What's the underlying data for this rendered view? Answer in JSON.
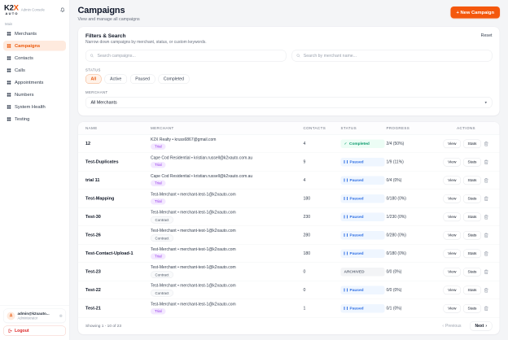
{
  "brand": {
    "logo_k2": "K2",
    "logo_x": "X",
    "logo_auto": "AUTO",
    "console_label": "Admin Console"
  },
  "sidebar": {
    "section_label": "Main",
    "items": [
      {
        "label": "Merchants",
        "active": false
      },
      {
        "label": "Campaigns",
        "active": true
      },
      {
        "label": "Contacts",
        "active": false
      },
      {
        "label": "Calls",
        "active": false
      },
      {
        "label": "Appointments",
        "active": false
      },
      {
        "label": "Numbers",
        "active": false
      },
      {
        "label": "System Health",
        "active": false
      },
      {
        "label": "Testing",
        "active": false
      }
    ],
    "user": {
      "avatar_initial": "A",
      "email": "admin@k2xauto...",
      "role": "Administrator"
    },
    "logout_label": "Logout"
  },
  "header": {
    "title": "Campaigns",
    "subtitle": "View and manage all campaigns",
    "new_campaign_label": "+ New Campaign"
  },
  "filters": {
    "title": "Filters & Search",
    "subtitle": "Narrow down campaigns by merchant, status, or custom keywords.",
    "reset_label": "Reset",
    "search_campaigns_placeholder": "Search campaigns...",
    "search_merchant_placeholder": "Search by merchant name...",
    "status_label": "STATUS",
    "status_options": [
      "All",
      "Active",
      "Paused",
      "Completed"
    ],
    "active_status": "All",
    "merchant_label": "MERCHANT",
    "merchant_value": "All Merchants"
  },
  "table": {
    "columns": [
      "NAME",
      "MERCHANT",
      "CONTACTS",
      "STATUS",
      "PROGRESS",
      "ACTIONS"
    ],
    "view_label": "View",
    "stats_label": "Stats",
    "rows": [
      {
        "name": "12",
        "merchant": "K2X Realty • kruss6867@gmail.com",
        "badge": "Trial",
        "badge_kind": "trial",
        "contacts": 4,
        "status": "Completed",
        "status_kind": "completed",
        "progress": "2/4 (50%)"
      },
      {
        "name": "Test-Duplicates",
        "merchant": "Cape Cod Residential • kristian.russell@k2xauto.com.au",
        "badge": "Trial",
        "badge_kind": "trial",
        "contacts": 9,
        "status": "Paused",
        "status_kind": "paused",
        "progress": "1/9 (11%)"
      },
      {
        "name": "trial 11",
        "merchant": "Cape Cod Residential • kristian.russell@k2xauto.com.au",
        "badge": "Trial",
        "badge_kind": "trial",
        "contacts": 4,
        "status": "Paused",
        "status_kind": "paused",
        "progress": "0/4 (0%)"
      },
      {
        "name": "Test-Mapping",
        "merchant": "Test-Merchant • merchant-test-1@k2xauto.com",
        "badge": "Trial",
        "badge_kind": "trial",
        "contacts": 180,
        "status": "Paused",
        "status_kind": "paused",
        "progress": "0/180 (0%)"
      },
      {
        "name": "Test-30",
        "merchant": "Test-Merchant • merchant-test-1@k2xauto.com",
        "badge": "Contract",
        "badge_kind": "contract",
        "contacts": 230,
        "status": "Paused",
        "status_kind": "paused",
        "progress": "1/230 (0%)"
      },
      {
        "name": "Test-26",
        "merchant": "Test-Merchant • merchant-test-1@k2xauto.com",
        "badge": "Contract",
        "badge_kind": "contract",
        "contacts": 280,
        "status": "Paused",
        "status_kind": "paused",
        "progress": "0/280 (0%)"
      },
      {
        "name": "Test-Contact-Upload-1",
        "merchant": "Test-Merchant • merchant-test-1@k2xauto.com",
        "badge": "Trial",
        "badge_kind": "trial",
        "contacts": 180,
        "status": "Paused",
        "status_kind": "paused",
        "progress": "0/180 (0%)"
      },
      {
        "name": "Test-23",
        "merchant": "Test-Merchant • merchant-test-1@k2xauto.com",
        "badge": "Contract",
        "badge_kind": "contract",
        "contacts": 0,
        "status": "ARCHIVED",
        "status_kind": "archived",
        "progress": "0/0 (0%)"
      },
      {
        "name": "Test-22",
        "merchant": "Test-Merchant • merchant-test-1@k2xauto.com",
        "badge": "Contract",
        "badge_kind": "contract",
        "contacts": 0,
        "status": "Paused",
        "status_kind": "paused",
        "progress": "0/0 (0%)"
      },
      {
        "name": "Test-21",
        "merchant": "Test-Merchant • merchant-test-1@k2xauto.com",
        "badge": "Trial",
        "badge_kind": "trial",
        "contacts": 1,
        "status": "Paused",
        "status_kind": "paused",
        "progress": "0/1 (0%)"
      }
    ]
  },
  "pagination": {
    "summary": "Showing 1 - 10 of 23",
    "previous_label": "Previous",
    "next_label": "Next"
  },
  "colors": {
    "accent_orange": "#f4570c",
    "paused_blue": "#2f6fe4",
    "completed_green": "#0a9a6c",
    "trial_purple": "#9333ea"
  }
}
